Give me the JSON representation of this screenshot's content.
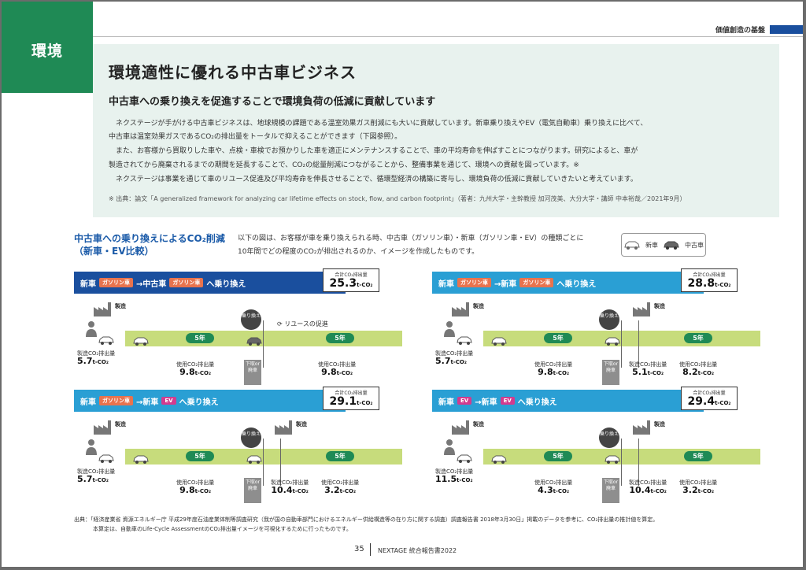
{
  "header": {
    "section_tab": "環境",
    "category": "価値創造の基盤"
  },
  "intro": {
    "title": "環境適性に優れる中古車ビジネス",
    "subtitle": "中古車への乗り換えを促進することで環境負荷の低減に貢献しています",
    "paragraphs": [
      "ネクステージが手がける中古車ビジネスは、地球規模の課題である温室効果ガス削減にも大いに貢献しています。新車乗り換えやEV（電気自動車）乗り換えに比べて、",
      "中古車は温室効果ガスであるCO₂の排出量をトータルで抑えることができます（下図参照）。",
      "また、お客様から買取りした車や、点検・車検でお預かりした車を適正にメンテナンスすることで、車の平均寿命を伸ばすことにつながります。研究によると、車が",
      "製造されてから廃棄されるまでの期間を延長することで、CO₂の総量削減につながることから、整備事業を通じて、環境への貢献を図っています。※",
      "ネクステージは事業を通じて車のリユース促進及び平均寿命を伸長させることで、循環型経済の構築に寄与し、環境負荷の低減に貢献していきたいと考えています。"
    ],
    "source_note": "※ 出典：論文「A generalized framework for analyzing car lifetime effects on stock, flow, and carbon footprint」（著者：九州大学・主幹教授 加河茂美、大分大学・講師 中本裕哉／2021年9月）"
  },
  "comparison": {
    "title_line1": "中古車への乗り換えによるCO₂削減",
    "title_line2": "（新車・EV比較）",
    "desc_line1": "以下の図は、お客様が車を乗り換えられる時、中古車（ガソリン車）・新車（ガソリン車・EV）の種類ごとに",
    "desc_line2": "10年間でどの程度のCO₂が排出されるのか、イメージを作成したものです。",
    "legend_new": "新車",
    "legend_used": "中古車"
  },
  "labels": {
    "new": "新車",
    "used": "中古車",
    "gas": "ガソリン車",
    "ev": "EV",
    "arrow": "→",
    "switch_suffix": "へ乗り換え",
    "total": "合計CO₂排出量",
    "manufacture": "製造",
    "manufacture_co2": "製造CO₂排出量",
    "use_co2": "使用CO₂排出量",
    "years": "5年",
    "swap": "乗り換え",
    "dispose": "下取or廃車",
    "reuse": "リユースの促進",
    "unit": "t-CO₂"
  },
  "panels": [
    {
      "from_type": "gas",
      "to": "中古車",
      "to_type": "gas",
      "total": "25.3",
      "mfg": "5.7",
      "use1": "9.8",
      "mid_mfg": "",
      "use2": "9.8",
      "reuse": true
    },
    {
      "from_type": "gas",
      "to": "新車",
      "to_type": "gas",
      "total": "28.8",
      "mfg": "5.7",
      "use1": "9.8",
      "mid_mfg": "5.1",
      "use2": "8.2",
      "reuse": false
    },
    {
      "from_type": "gas",
      "to": "新車",
      "to_type": "ev",
      "total": "29.1",
      "mfg": "5.7",
      "use1": "9.8",
      "mid_mfg": "10.4",
      "use2": "3.2",
      "reuse": false
    },
    {
      "from_type": "ev",
      "to": "新車",
      "to_type": "ev",
      "total": "29.4",
      "mfg": "11.5",
      "use1": "4.3",
      "mid_mfg": "10.4",
      "use2": "3.2",
      "reuse": false
    }
  ],
  "colors": {
    "panel1": "#1a4f9e",
    "panel_other": "#2a9fd4",
    "accent_green": "#1f8a55",
    "track": "#c7dc7c"
  },
  "footer": {
    "line1": "出典：「経済産業省 資源エネルギー庁 平成29年度石油産業体制等調査研究（我が国の自動車部門におけるエネルギー供給構造等の在り方に関する調査）調査報告書 2018年3月30日」掲載のデータを参考に、CO₂排出量の推計値を算定。",
    "line2": "本算定は、自動車のLife-Cycle AssessmentのCO₂排出量イメージを可視化するために行ったものです。",
    "page_number": "35",
    "report_name": "NEXTAGE 統合報告書2022"
  }
}
